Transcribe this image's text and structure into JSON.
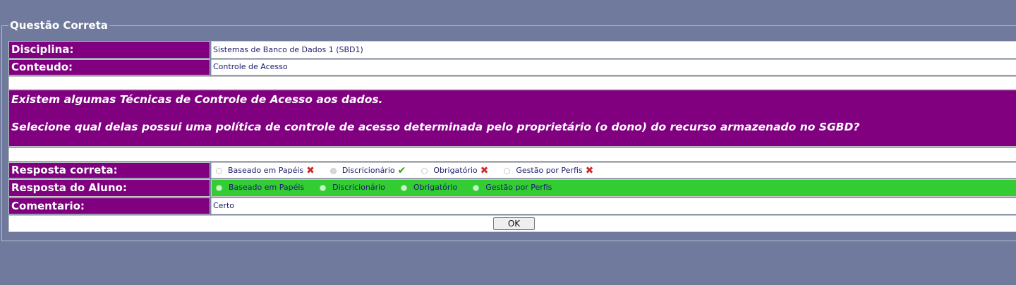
{
  "legend": "Questão Correta",
  "disciplina": {
    "label": "Disciplina:",
    "value": "Sistemas de Banco de Dados 1 (SBD1)"
  },
  "conteudo": {
    "label": "Conteudo:",
    "value": "Controle de Acesso"
  },
  "question": {
    "line1": "Existem algumas Técnicas de Controle de Acesso aos dados.",
    "line2": "Selecione qual delas possui uma política de controle de acesso determinada pelo proprietário (o dono) do recurso armazenado no SGBD?"
  },
  "resposta_correta": {
    "label": "Resposta correta:",
    "options": [
      {
        "label": "Baseado em Papéis",
        "mark": "wrong-x-icon",
        "checked": false
      },
      {
        "label": "Discricionário",
        "mark": "correct-check-icon",
        "checked": true
      },
      {
        "label": "Obrigatório",
        "mark": "wrong-x-icon",
        "checked": false
      },
      {
        "label": "Gestão por Perfis",
        "mark": "wrong-x-icon",
        "checked": false
      }
    ]
  },
  "resposta_aluno": {
    "label": "Resposta do Aluno:",
    "options": [
      {
        "label": "Baseado em Papéis"
      },
      {
        "label": "Discricionário"
      },
      {
        "label": "Obrigatório"
      },
      {
        "label": "Gestão por Perfis"
      }
    ]
  },
  "comentario": {
    "label": "Comentario:",
    "value": "Certo"
  },
  "ok_button": "OK",
  "colors": {
    "background": "#6f7a9c",
    "label_bg": "#800080",
    "student_row_bg": "#33cc33"
  }
}
